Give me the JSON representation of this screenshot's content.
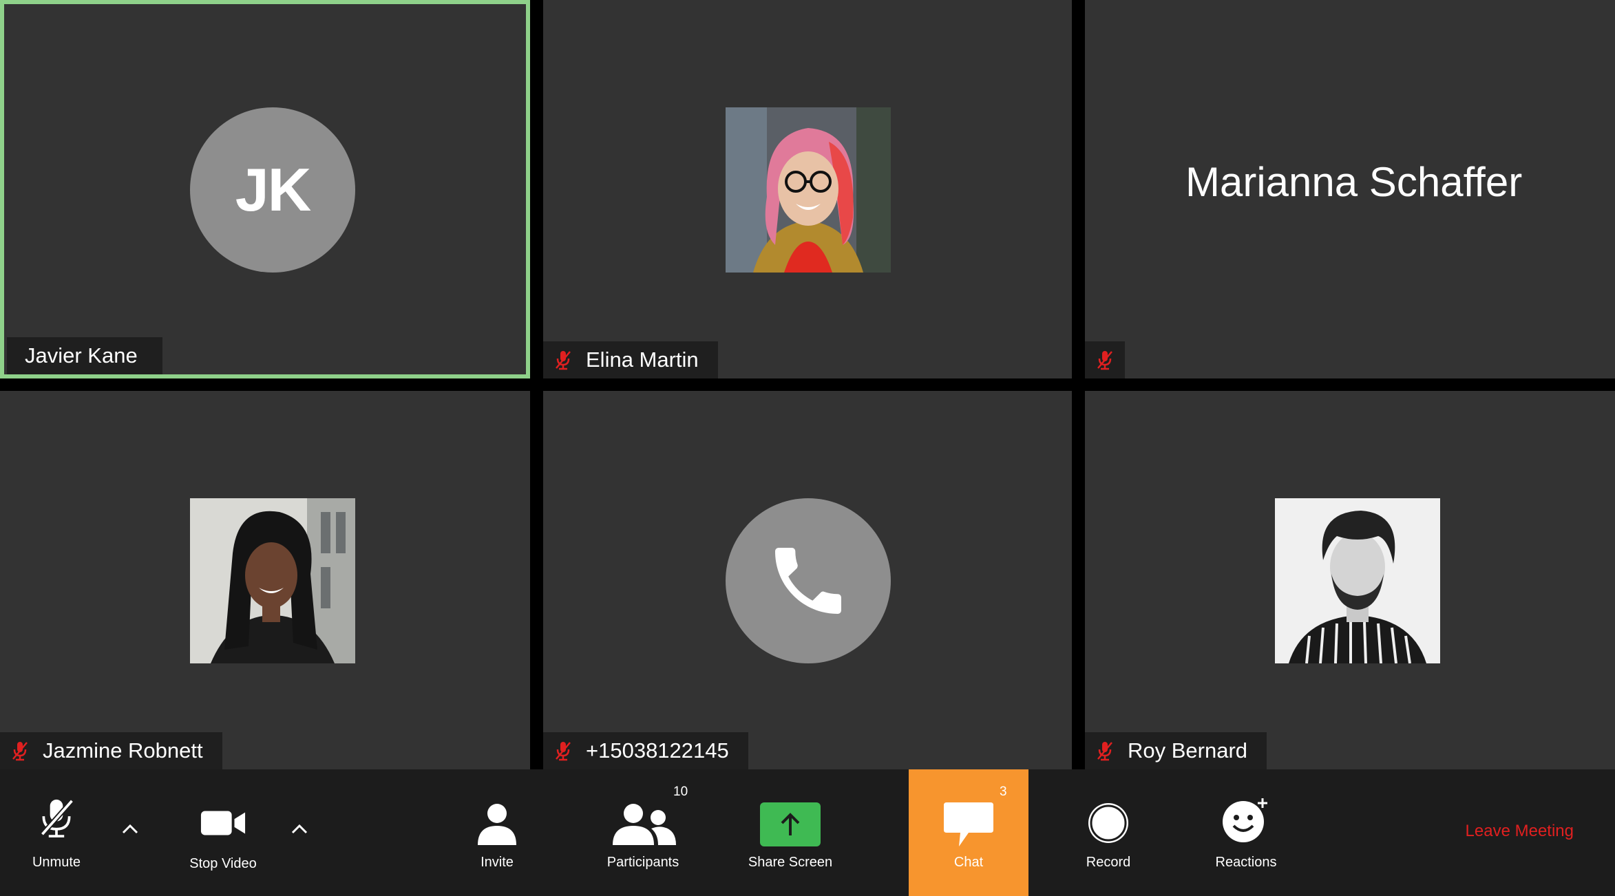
{
  "participants": [
    {
      "name": "Javier Kane",
      "initials": "JK",
      "muted": false,
      "active": true
    },
    {
      "name": "Elina Martin",
      "muted": true
    },
    {
      "name": "Marianna Schaffer",
      "muted": true
    },
    {
      "name": "Jazmine Robnett",
      "muted": true
    },
    {
      "name": "+15038122145",
      "muted": true
    },
    {
      "name": "Roy Bernard",
      "muted": true
    }
  ],
  "toolbar": {
    "unmute_label": "Unmute",
    "stop_video_label": "Stop Video",
    "invite_label": "Invite",
    "participants_label": "Participants",
    "participants_count": "10",
    "share_screen_label": "Share Screen",
    "chat_label": "Chat",
    "chat_count": "3",
    "record_label": "Record",
    "reactions_label": "Reactions",
    "leave_label": "Leave Meeting"
  },
  "colors": {
    "tile_bg": "#333333",
    "active_border": "#8fd18a",
    "muted_icon": "#e02020",
    "share_screen": "#3fba53",
    "chat_active": "#f7952e",
    "leave": "#e02020"
  },
  "icons": [
    "muted-mic-icon",
    "camera-icon",
    "chevron-up-icon",
    "person-icon",
    "people-icon",
    "share-arrow-icon",
    "chat-bubble-icon",
    "record-icon",
    "reaction-smiley-icon",
    "phone-icon"
  ]
}
